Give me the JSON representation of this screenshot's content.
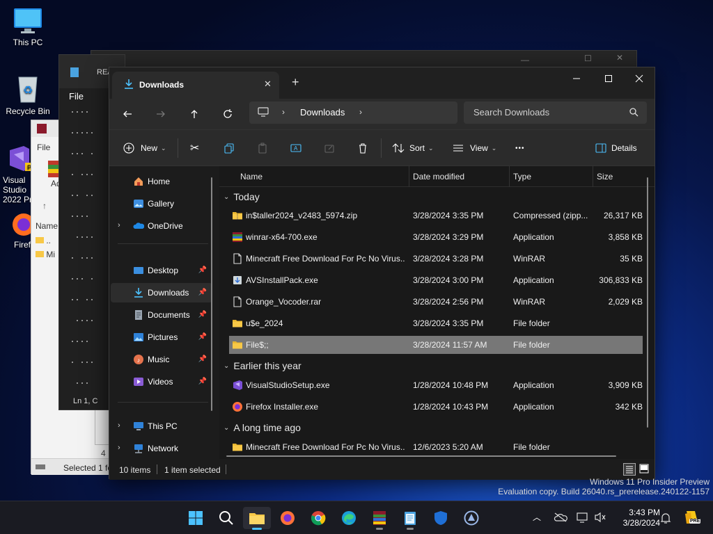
{
  "desktop": {
    "icons": [
      {
        "label": "This PC"
      },
      {
        "label": "Recycle Bin"
      },
      {
        "label": "Visual Studio 2022 Pr"
      },
      {
        "label": "Firef"
      }
    ]
  },
  "background_windows": {
    "notepad": {
      "title": "REA",
      "menu_file": "File",
      "status": "Ln 1, C"
    },
    "winrar": {
      "menu_file": "File",
      "col_name": "Name",
      "row_parent": "..",
      "row_item": "Mi",
      "status": "Selected 1 fo",
      "add_label": "Ad",
      "second_file": "Fi",
      "second_name": "Na",
      "second_status": "4"
    }
  },
  "explorer": {
    "tab_title": "Downloads",
    "search_placeholder": "Search Downloads",
    "breadcrumb": [
      "Downloads"
    ],
    "toolbar": {
      "new_label": "New",
      "sort_label": "Sort",
      "view_label": "View",
      "more_label": "•••",
      "details_label": "Details"
    },
    "nav": {
      "home": "Home",
      "gallery": "Gallery",
      "onedrive": "OneDrive",
      "desktop": "Desktop",
      "downloads": "Downloads",
      "documents": "Documents",
      "pictures": "Pictures",
      "music": "Music",
      "videos": "Videos",
      "this_pc": "This PC",
      "network": "Network"
    },
    "columns": {
      "name": "Name",
      "date": "Date modified",
      "type": "Type",
      "size": "Size"
    },
    "groups": {
      "today": "Today",
      "earlier": "Earlier this year",
      "long_ago": "A long time ago"
    },
    "files_today": [
      {
        "name": "in$taller2024_v2483_5974.zip",
        "date": "3/28/2024 3:35 PM",
        "type": "Compressed (zipp...",
        "size": "26,317 KB",
        "icon": "zip-icon"
      },
      {
        "name": "winrar-x64-700.exe",
        "date": "3/28/2024 3:29 PM",
        "type": "Application",
        "size": "3,858 KB",
        "icon": "winrar-icon"
      },
      {
        "name": "Minecraft Free Download For Pc No Virus...",
        "date": "3/28/2024 3:28 PM",
        "type": "WinRAR",
        "size": "35 KB",
        "icon": "file-icon"
      },
      {
        "name": "AVSInstallPack.exe",
        "date": "3/28/2024 3:00 PM",
        "type": "Application",
        "size": "306,833 KB",
        "icon": "installer-icon"
      },
      {
        "name": "Orange_Vocoder.rar",
        "date": "3/28/2024 2:56 PM",
        "type": "WinRAR",
        "size": "2,029 KB",
        "icon": "file-icon"
      },
      {
        "name": "u$e_2024",
        "date": "3/28/2024 3:35 PM",
        "type": "File folder",
        "size": "",
        "icon": "folder-icon"
      },
      {
        "name": "File$;;",
        "date": "3/28/2024 11:57 AM",
        "type": "File folder",
        "size": "",
        "icon": "folder-icon"
      }
    ],
    "files_earlier": [
      {
        "name": "VisualStudioSetup.exe",
        "date": "1/28/2024 10:48 PM",
        "type": "Application",
        "size": "3,909 KB",
        "icon": "vs-icon"
      },
      {
        "name": "Firefox Installer.exe",
        "date": "1/28/2024 10:43 PM",
        "type": "Application",
        "size": "342 KB",
        "icon": "firefox-icon"
      }
    ],
    "files_long_ago": [
      {
        "name": "Minecraft Free Download For Pc No Virus...",
        "date": "12/6/2023 5:20 AM",
        "type": "File folder",
        "size": "",
        "icon": "folder-icon"
      }
    ],
    "status": {
      "count": "10 items",
      "selected": "1 item selected"
    }
  },
  "watermark": {
    "line1": "Windows 11 Pro Insider Preview",
    "line2": "Evaluation copy. Build 26040.rs_prerelease.240122-1157"
  },
  "taskbar": {
    "time": "3:43 PM",
    "date": "3/28/2024",
    "pre_badge": "PRE"
  },
  "colors": {
    "accent": "#4cc2ff",
    "folder": "#f8c847",
    "selected_row": "#777777"
  }
}
